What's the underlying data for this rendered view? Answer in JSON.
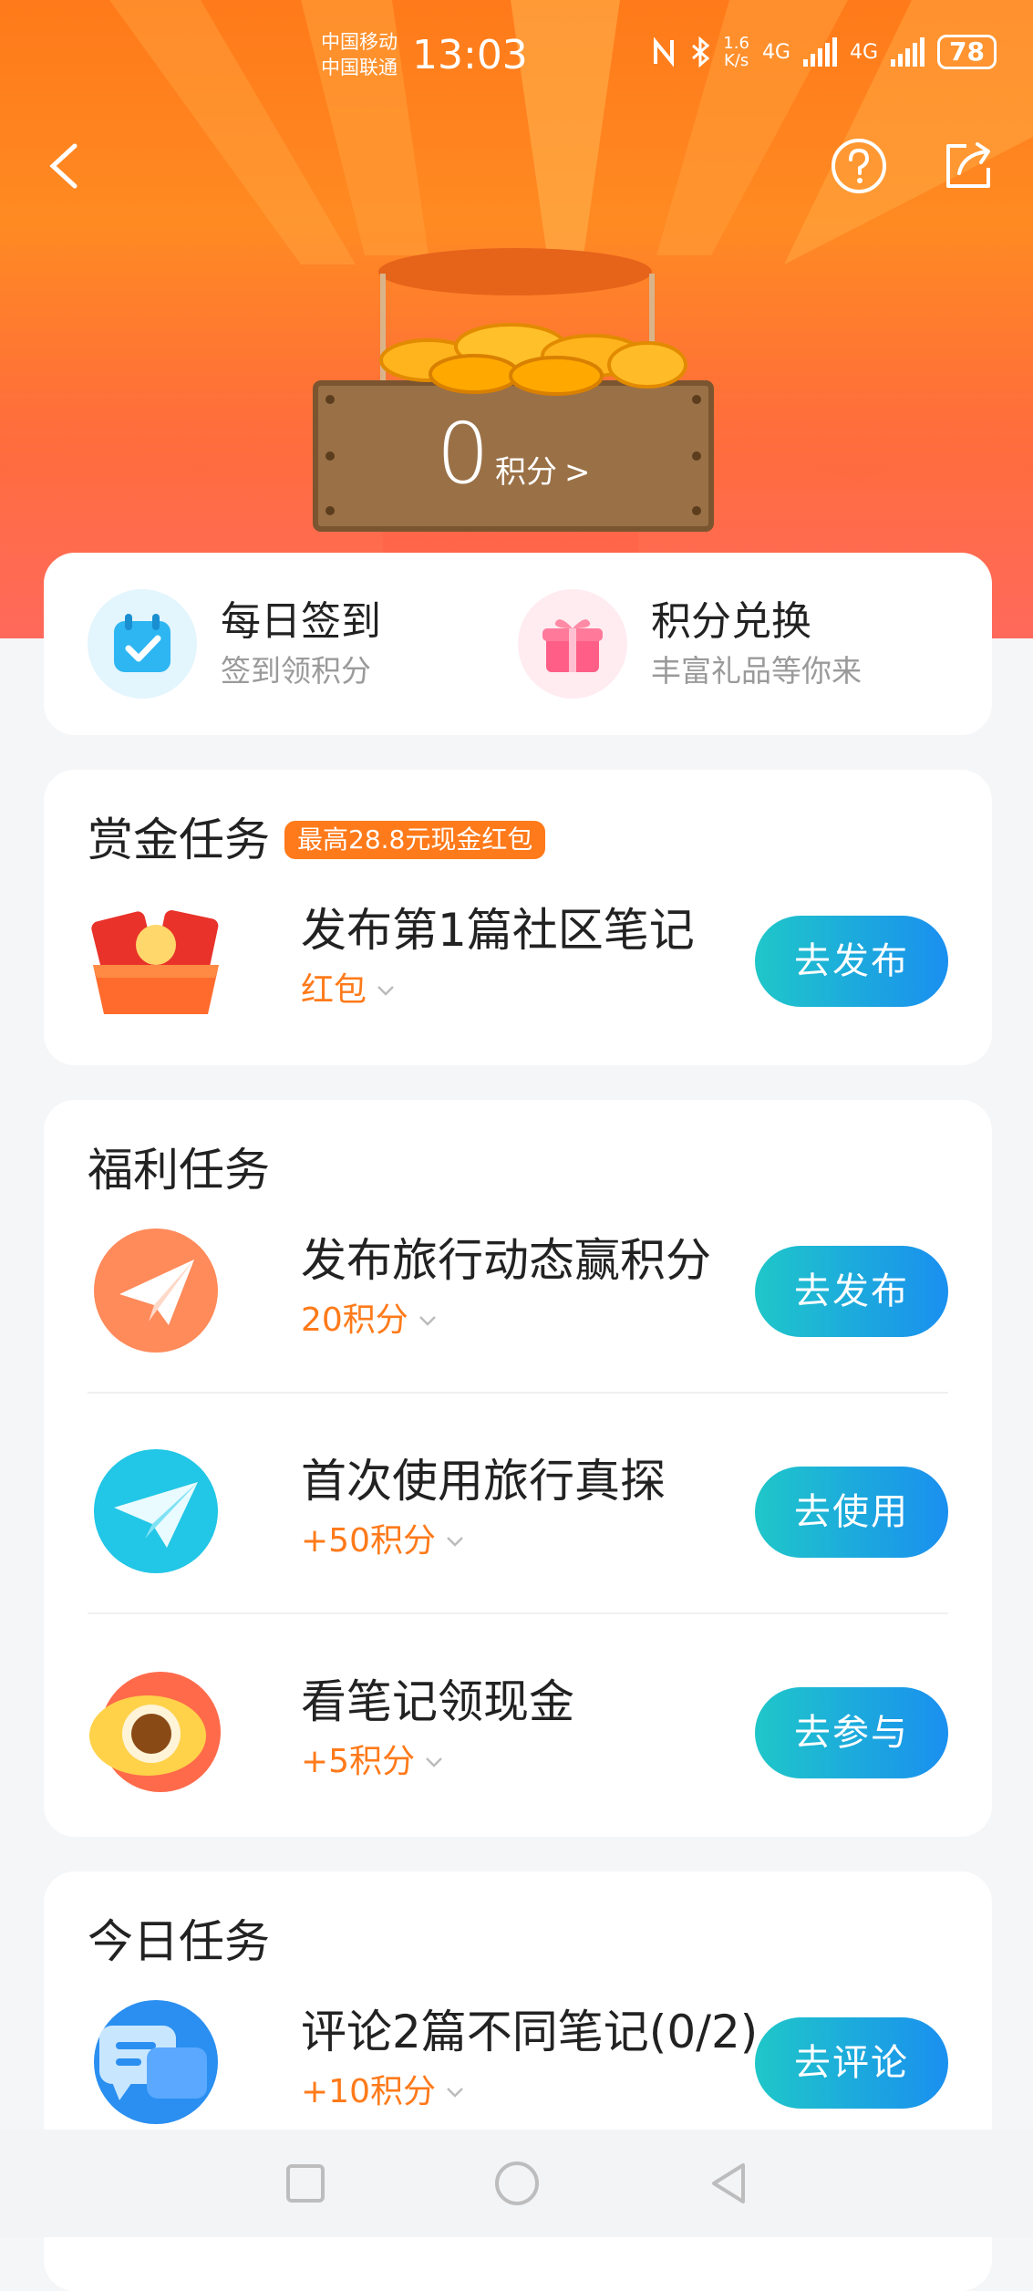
{
  "status_bar": {
    "carrier_1": "中国移动",
    "carrier_2": "中国联通",
    "time": "13:03",
    "net_speed_value": "1.6",
    "net_speed_unit": "K/s",
    "network_1": "4G",
    "network_2": "4G",
    "battery": "78"
  },
  "header": {
    "icons": [
      "back-icon",
      "help-icon",
      "share-icon"
    ],
    "points_value": "0",
    "points_unit": "积分",
    "points_arrow": ">"
  },
  "entries": [
    {
      "title": "每日签到",
      "subtitle": "签到领积分",
      "icon": "calendar-check-icon",
      "color": "#2eb6f2"
    },
    {
      "title": "积分兑换",
      "subtitle": "丰富礼品等你来",
      "icon": "gift-icon",
      "color": "#ff5f86"
    }
  ],
  "bounty": {
    "title": "赏金任务",
    "badge": "最高28.8元现金红包",
    "tasks": [
      {
        "title": "发布第1篇社区笔记",
        "reward": "红包",
        "button": "去发布",
        "icon": "red-envelope-icon"
      }
    ]
  },
  "welfare": {
    "title": "福利任务",
    "tasks": [
      {
        "title": "发布旅行动态赢积分",
        "reward": "20积分",
        "button": "去发布",
        "icon": "paper-plane-icon"
      },
      {
        "title": "首次使用旅行真探",
        "reward": "+50积分",
        "button": "去使用",
        "icon": "send-icon"
      },
      {
        "title": "看笔记领现金",
        "reward": "+5积分",
        "button": "去参与",
        "icon": "eye-icon"
      }
    ]
  },
  "today": {
    "title": "今日任务",
    "tasks": [
      {
        "title": "评论2篇不同笔记(0/2)",
        "reward": "+10积分",
        "button": "去评论",
        "icon": "comment-icon"
      }
    ]
  },
  "colors": {
    "accent": "#ff7a1a",
    "button_start": "#1fc7c8",
    "button_end": "#1a8ff0"
  },
  "nav_bar": {
    "icons": [
      "recent-apps-icon",
      "home-icon",
      "back-nav-icon"
    ]
  }
}
